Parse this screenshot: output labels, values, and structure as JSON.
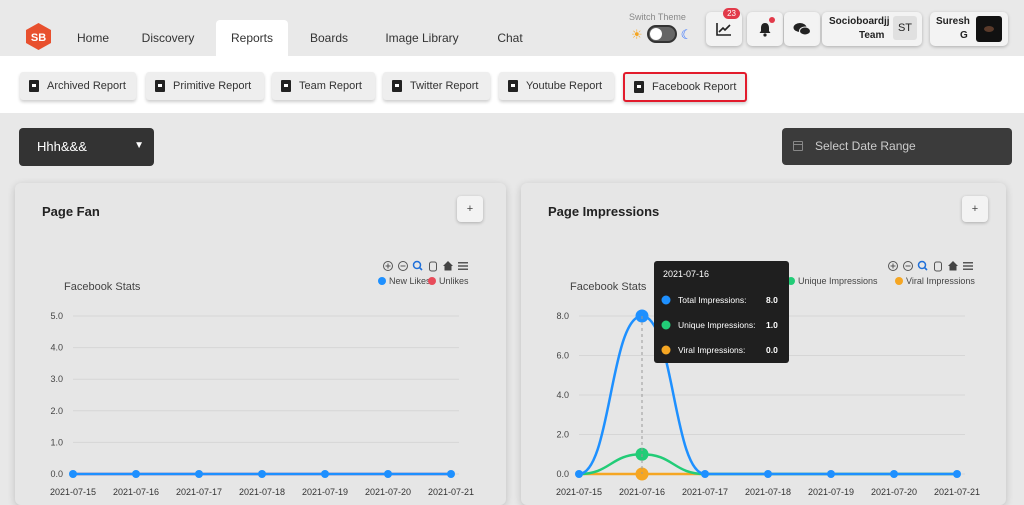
{
  "nav": {
    "logo_text": "SB",
    "tabs": [
      {
        "label": "Home"
      },
      {
        "label": "Discovery"
      },
      {
        "label": "Reports"
      },
      {
        "label": "Boards"
      },
      {
        "label": "Image Library"
      },
      {
        "label": "Chat"
      }
    ],
    "active_tab": "Reports",
    "switch_theme_label": "Switch Theme",
    "notification_badge": "23",
    "team": {
      "name": "Socioboardjj",
      "sub": "Team",
      "initials": "ST"
    },
    "user": {
      "name": "Suresh",
      "initial": "G"
    }
  },
  "report_tabs": [
    {
      "label": "Archived Report"
    },
    {
      "label": "Primitive Report"
    },
    {
      "label": "Team Report"
    },
    {
      "label": "Twitter Report"
    },
    {
      "label": "Youtube Report"
    },
    {
      "label": "Facebook Report"
    }
  ],
  "active_report": "Facebook Report",
  "filters": {
    "account_selected": "Hhh&&&",
    "date_placeholder": "Select Date Range"
  },
  "colors": {
    "accent_red": "#e21b2c",
    "new_likes": "#1e90ff",
    "unlikes": "#e84c5a",
    "total_impressions": "#1e90ff",
    "unique_impressions": "#22cc77",
    "viral_impressions": "#f5a623"
  },
  "chart_data": [
    {
      "type": "line",
      "card_title": "Page Fan",
      "title": "Facebook Stats",
      "x": [
        "2021-07-15",
        "2021-07-16",
        "2021-07-17",
        "2021-07-18",
        "2021-07-19",
        "2021-07-20",
        "2021-07-21"
      ],
      "series": [
        {
          "name": "New Likes",
          "values": [
            0,
            0,
            0,
            0,
            0,
            0,
            0
          ]
        },
        {
          "name": "Unlikes",
          "values": [
            0,
            0,
            0,
            0,
            0,
            0,
            0
          ]
        }
      ],
      "yticks": [
        "0.0",
        "1.0",
        "2.0",
        "3.0",
        "4.0",
        "5.0"
      ],
      "ylim": [
        0,
        5
      ],
      "legend": "top-right"
    },
    {
      "type": "line",
      "card_title": "Page Impressions",
      "title": "Facebook Stats",
      "x": [
        "2021-07-15",
        "2021-07-16",
        "2021-07-17",
        "2021-07-18",
        "2021-07-19",
        "2021-07-20",
        "2021-07-21"
      ],
      "series": [
        {
          "name": "Total Impressions",
          "values": [
            0,
            8,
            0,
            0,
            0,
            0,
            0
          ]
        },
        {
          "name": "Unique Impressions",
          "values": [
            0,
            1,
            0,
            0,
            0,
            0,
            0
          ]
        },
        {
          "name": "Viral Impressions",
          "values": [
            0,
            0,
            0,
            0,
            0,
            0,
            0
          ]
        }
      ],
      "yticks": [
        "0.0",
        "2.0",
        "4.0",
        "6.0",
        "8.0"
      ],
      "ylim": [
        0,
        8
      ],
      "legend": "top-right",
      "tooltip": {
        "date": "2021-07-16",
        "rows": [
          {
            "label": "Total Impressions:",
            "value": "8.0"
          },
          {
            "label": "Unique Impressions:",
            "value": "1.0"
          },
          {
            "label": "Viral Impressions:",
            "value": "0.0"
          }
        ]
      }
    }
  ]
}
